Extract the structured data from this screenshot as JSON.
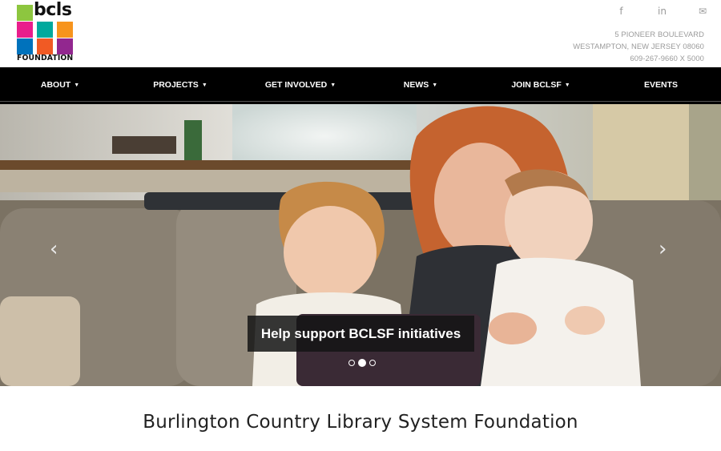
{
  "logo": {
    "wordmark": "bcls",
    "subtitle": "FOUNDATION",
    "colors": [
      "#8dc63f",
      "#e91e8c",
      "#00a99d",
      "#f7941d",
      "#0072bc",
      "#f15a24",
      "#92278f"
    ]
  },
  "social": [
    {
      "name": "facebook-icon",
      "glyph": "f"
    },
    {
      "name": "linkedin-icon",
      "glyph": "in"
    },
    {
      "name": "mail-icon",
      "glyph": "✉"
    }
  ],
  "address": {
    "street": "5 PIONEER BOULEVARD",
    "city": "WESTAMPTON, NEW JERSEY 08060",
    "phone": "609-267-9660 X 5000"
  },
  "nav": {
    "items": [
      {
        "label": "ABOUT",
        "dropdown": true
      },
      {
        "label": "PROJECTS",
        "dropdown": true
      },
      {
        "label": "GET INVOLVED",
        "dropdown": true
      },
      {
        "label": "NEWS",
        "dropdown": true
      },
      {
        "label": "JOIN BCLSF",
        "dropdown": true
      },
      {
        "label": "EVENTS",
        "dropdown": false
      }
    ],
    "caret": "▼"
  },
  "hero": {
    "caption": "Help support BCLSF initiatives",
    "prev_glyph": "‹",
    "next_glyph": "›",
    "slide_count": 3,
    "active_slide": 2
  },
  "site_title": "Burlington Country Library System Foundation"
}
